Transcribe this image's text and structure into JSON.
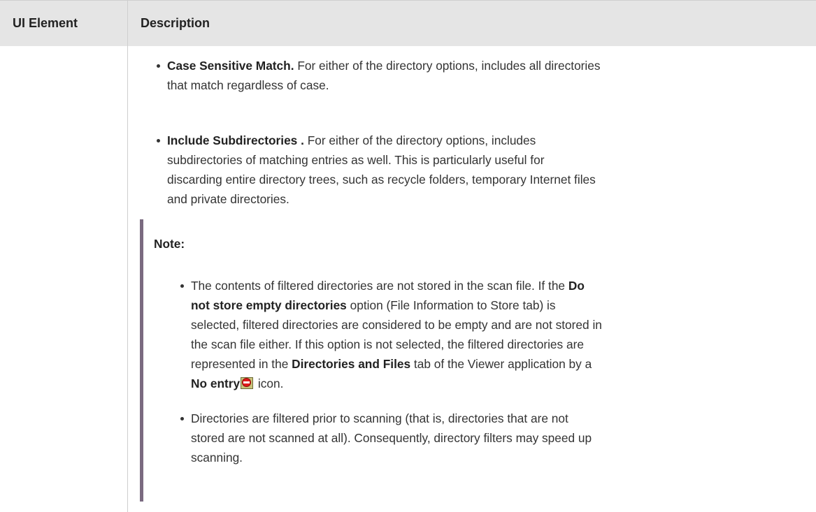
{
  "table": {
    "headers": {
      "ui_element": "UI Element",
      "description": "Description"
    }
  },
  "options": [
    {
      "term": "Case Sensitive Match.",
      "text_lines": [
        " For either of the directory options, includes all directories",
        "that match regardless of case."
      ]
    },
    {
      "term": "Include Subdirectories .",
      "text_lines": [
        " For either of the directory options, includes",
        "subdirectories of matching entries as well. This is particularly useful for",
        "discarding entire directory trees, such as recycle folders, temporary Internet files",
        "and private directories."
      ]
    }
  ],
  "note": {
    "title": "Note:",
    "item1": {
      "seg1": "The contents of filtered directories are not stored in the scan file. If the ",
      "bold1": "Do",
      "bold1b": "not store empty directories",
      "seg2": " option (File Information to Store tab) is",
      "line3": "selected, filtered directories are considered to be empty and are not stored in",
      "line4": "the scan file either. If this option is not selected, the filtered directories are",
      "seg3": "represented in the ",
      "bold2": "Directories and Files",
      "seg4": " tab of the Viewer application by a",
      "bold3": "No entry",
      "icon": "no-entry-icon",
      "seg5": " icon."
    },
    "item2": {
      "lines": [
        "Directories are filtered prior to scanning (that is, directories that are not",
        "stored are not scanned at all). Consequently, directory filters may speed up",
        "scanning."
      ]
    }
  },
  "colors": {
    "header_bg": "#e5e5e5",
    "note_bar": "#7a6a80",
    "text": "#333333"
  }
}
